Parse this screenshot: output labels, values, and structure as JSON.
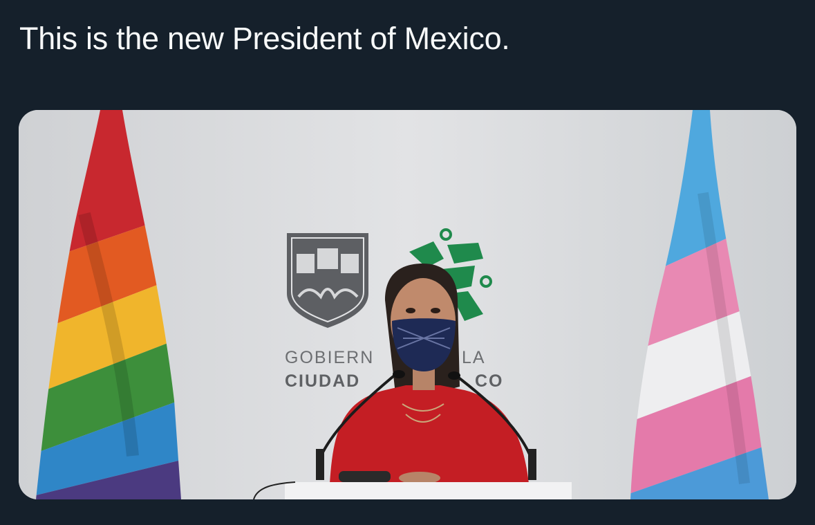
{
  "tweet": {
    "text": "This is the new President of Mexico."
  },
  "media": {
    "logo_line1_left": "GOBIERN",
    "logo_line1_right": "LA",
    "logo_line2_left": "CIUDAD",
    "logo_line2_right": "CO"
  }
}
